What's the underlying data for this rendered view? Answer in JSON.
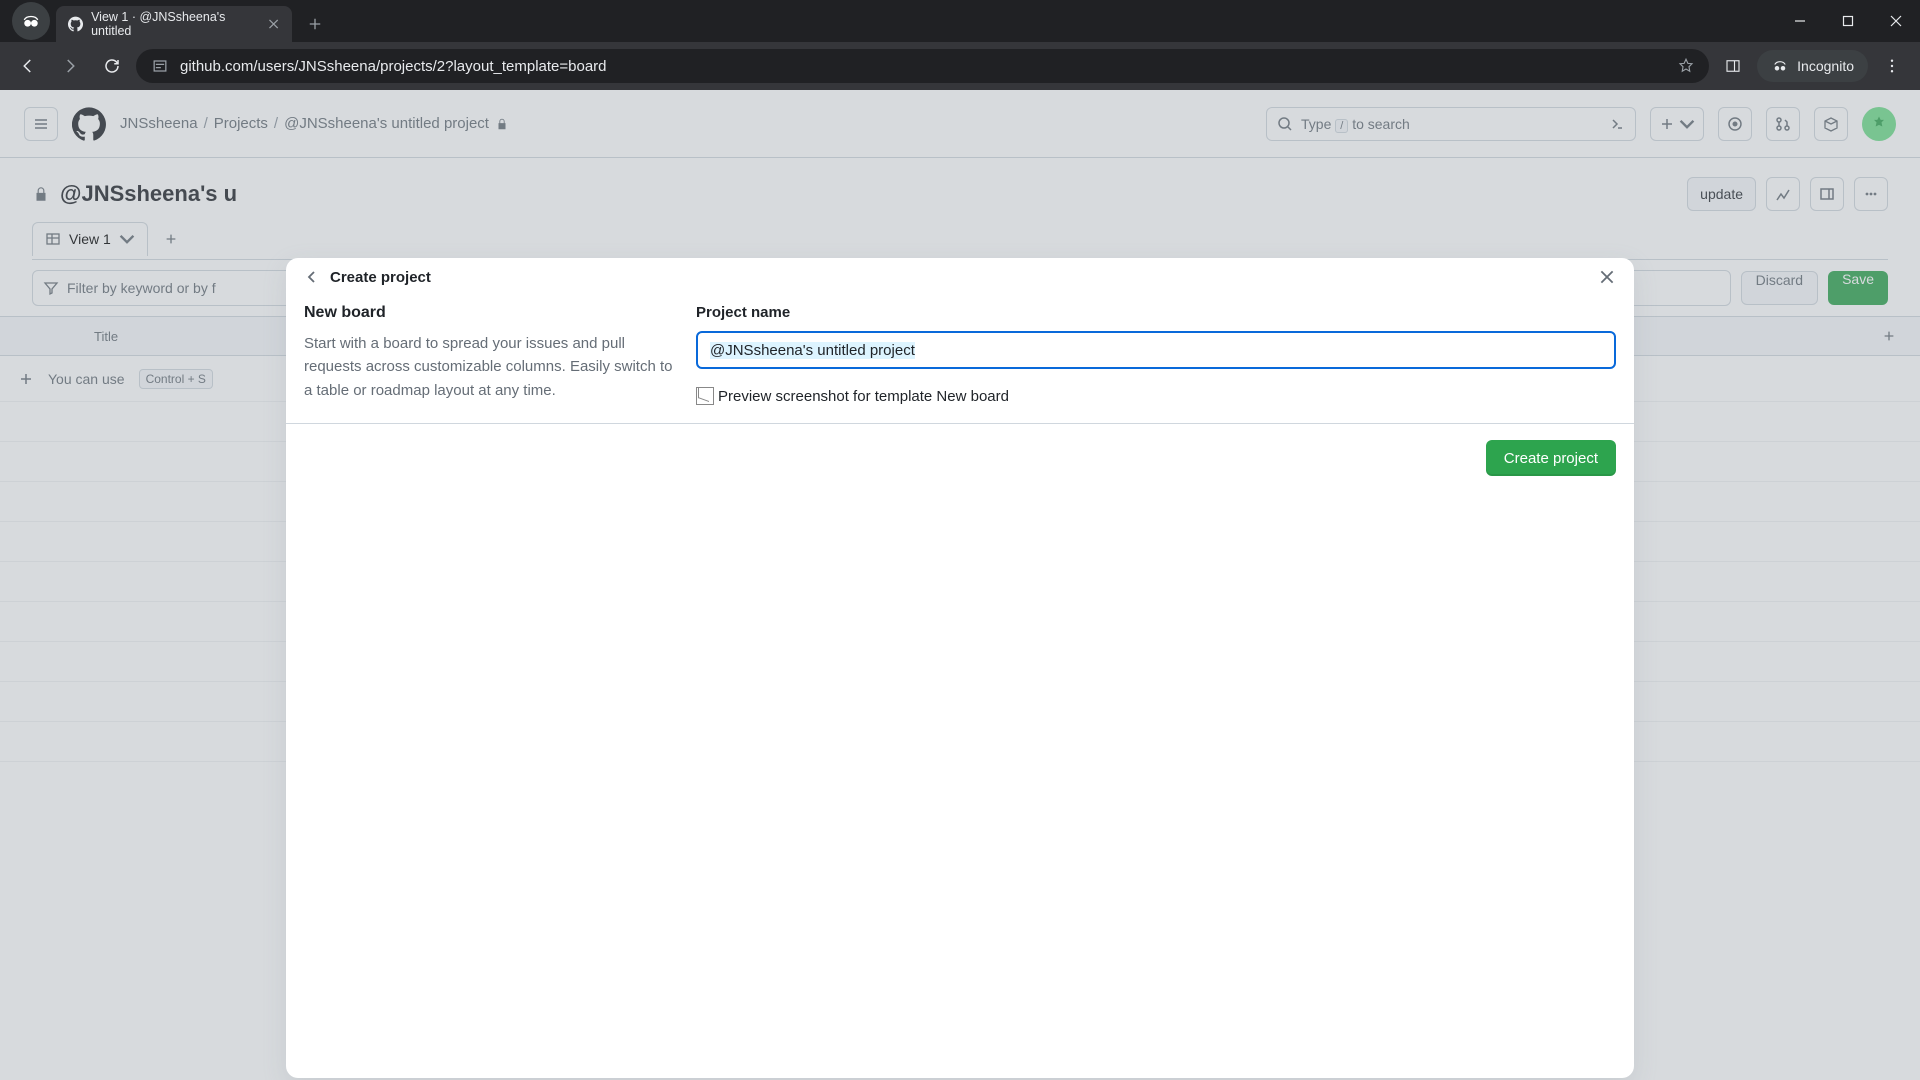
{
  "browser": {
    "tab_title": "View 1 · @JNSsheena's untitled",
    "url": "github.com/users/JNSsheena/projects/2?layout_template=board",
    "incognito_label": "Incognito"
  },
  "github_header": {
    "user": "JNSsheena",
    "breadcrumb_projects": "Projects",
    "breadcrumb_current": "@JNSsheena's untitled project",
    "search_placeholder": "Type / to search"
  },
  "project": {
    "title": "@JNSsheena's u",
    "update_button": "update",
    "view_tab": "View 1",
    "filter_placeholder": "Filter by keyword or by f",
    "discard": "Discard",
    "save": "Save",
    "col_title": "Title",
    "hint_prefix": "You can use",
    "hint_kbd": "Control + S"
  },
  "modal": {
    "header": "Create project",
    "left_heading": "New board",
    "left_desc": "Start with a board to spread your issues and pull requests across customizable columns. Easily switch to a table or roadmap layout at any time.",
    "field_label": "Project name",
    "input_value": "@JNSsheena's untitled project",
    "preview_alt": "Preview screenshot for template New board",
    "create_button": "Create project"
  }
}
